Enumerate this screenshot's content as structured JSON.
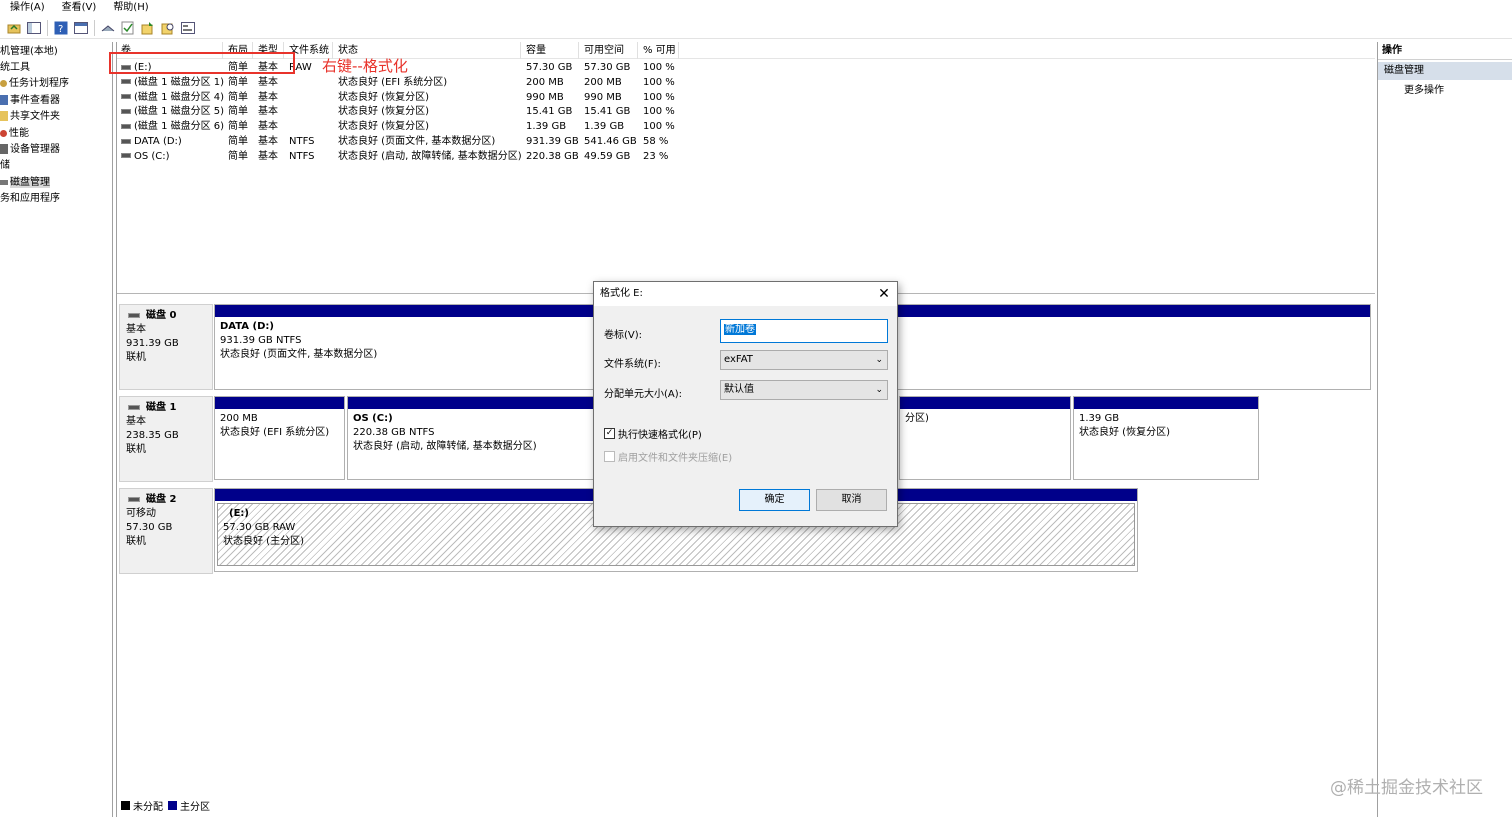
{
  "menu": [
    "操作(A)",
    "查看(V)",
    "帮助(H)"
  ],
  "tree": {
    "items": [
      {
        "label": "机管理(本地)",
        "indent": 0
      },
      {
        "label": "统工具",
        "indent": 0
      },
      {
        "label": "任务计划程序",
        "indent": 1
      },
      {
        "label": "事件查看器",
        "indent": 1
      },
      {
        "label": "共享文件夹",
        "indent": 1
      },
      {
        "label": "性能",
        "indent": 1
      },
      {
        "label": "设备管理器",
        "indent": 1
      },
      {
        "label": "储",
        "indent": 0
      },
      {
        "label": "磁盘管理",
        "indent": 1,
        "selected": true
      },
      {
        "label": "务和应用程序",
        "indent": 0
      }
    ]
  },
  "volume_list": {
    "headers": [
      "卷",
      "布局",
      "类型",
      "文件系统",
      "状态",
      "容量",
      "可用空间",
      "% 可用"
    ],
    "rows": [
      [
        "(E:)",
        "简单",
        "基本",
        "RAW",
        "",
        "57.30 GB",
        "57.30 GB",
        "100 %"
      ],
      [
        "(磁盘 1 磁盘分区 1)",
        "简单",
        "基本",
        "",
        "状态良好 (EFI 系统分区)",
        "200 MB",
        "200 MB",
        "100 %"
      ],
      [
        "(磁盘 1 磁盘分区 4)",
        "简单",
        "基本",
        "",
        "状态良好 (恢复分区)",
        "990 MB",
        "990 MB",
        "100 %"
      ],
      [
        "(磁盘 1 磁盘分区 5)",
        "简单",
        "基本",
        "",
        "状态良好 (恢复分区)",
        "15.41 GB",
        "15.41 GB",
        "100 %"
      ],
      [
        "(磁盘 1 磁盘分区 6)",
        "简单",
        "基本",
        "",
        "状态良好 (恢复分区)",
        "1.39 GB",
        "1.39 GB",
        "100 %"
      ],
      [
        "DATA (D:)",
        "简单",
        "基本",
        "NTFS",
        "状态良好 (页面文件, 基本数据分区)",
        "931.39 GB",
        "541.46 GB",
        "58 %"
      ],
      [
        "OS (C:)",
        "简单",
        "基本",
        "NTFS",
        "状态良好 (启动, 故障转储, 基本数据分区)",
        "220.38 GB",
        "49.59 GB",
        "23 %"
      ]
    ]
  },
  "annotation": {
    "text": "右键--格式化",
    "color": "#e8332b"
  },
  "disks": [
    {
      "name": "磁盘 0",
      "type": "基本",
      "size": "931.39 GB",
      "state": "联机",
      "partitions": [
        {
          "title": "DATA  (D:)",
          "line1": "931.39 GB NTFS",
          "line2": "状态良好 (页面文件, 基本数据分区)"
        }
      ]
    },
    {
      "name": "磁盘 1",
      "type": "基本",
      "size": "238.35 GB",
      "state": "联机",
      "partitions": [
        {
          "title": "",
          "line1": "200 MB",
          "line2": "状态良好 (EFI 系统分区)"
        },
        {
          "title": "OS  (C:)",
          "line1": "220.38 GB NTFS",
          "line2": "状态良好 (启动, 故障转储, 基本数据分区)"
        },
        {
          "title": "",
          "line1": "",
          "line2": "分区)"
        },
        {
          "title": "",
          "line1": "1.39 GB",
          "line2": "状态良好 (恢复分区)"
        }
      ]
    },
    {
      "name": "磁盘 2",
      "type": "可移动",
      "size": "57.30 GB",
      "state": "联机",
      "partitions": [
        {
          "title": "(E:)",
          "line1": "57.30 GB RAW",
          "line2": "状态良好 (主分区)"
        }
      ]
    }
  ],
  "legend": [
    {
      "label": "未分配",
      "color": "#000000"
    },
    {
      "label": "主分区",
      "color": "#00008a"
    }
  ],
  "actions": {
    "header": "操作",
    "section": "磁盘管理",
    "more": "更多操作"
  },
  "dialog": {
    "title": "格式化 E:",
    "volume_label_label": "卷标(V):",
    "volume_label_value": "新加卷",
    "fs_label": "文件系统(F):",
    "fs_value": "exFAT",
    "alloc_label": "分配单元大小(A):",
    "alloc_value": "默认值",
    "quick_format": "执行快速格式化(P)",
    "compression": "启用文件和文件夹压缩(E)",
    "ok": "确定",
    "cancel": "取消"
  },
  "watermark": "@稀土掘金技术社区",
  "colors": {
    "primary_partition": "#00008a",
    "accent": "#0078d7",
    "annotation": "#e8332b"
  }
}
